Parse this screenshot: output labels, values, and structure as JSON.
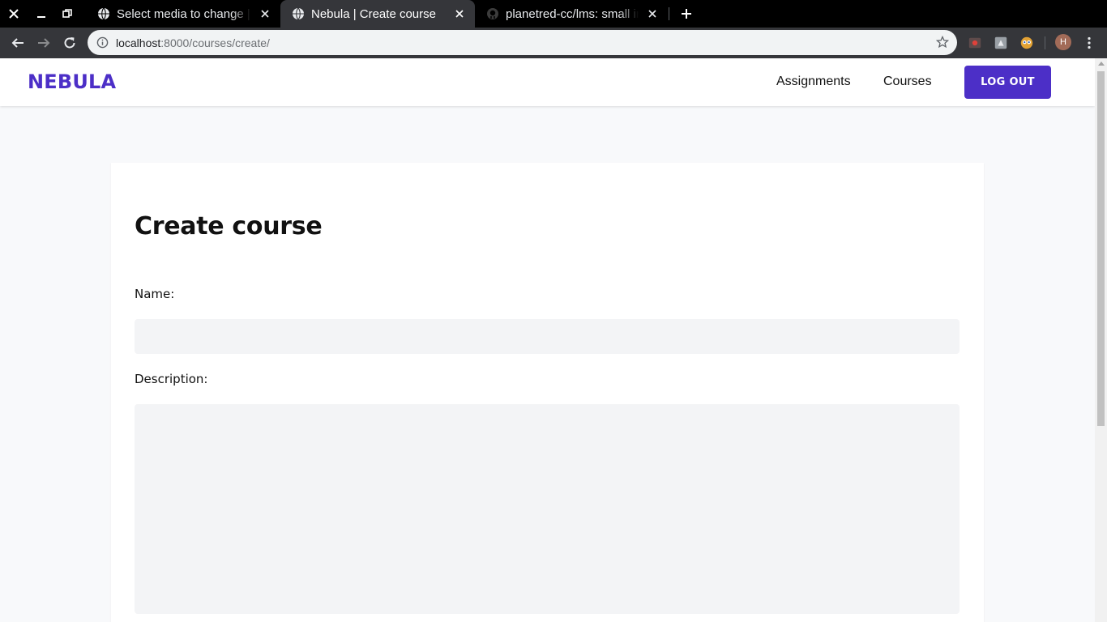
{
  "browser": {
    "tabs": [
      {
        "title": "Select media to change | Django site admin",
        "active": false
      },
      {
        "title": "Nebula | Create course",
        "active": true
      },
      {
        "title": "planetred-cc/lms: small improvements",
        "active": false
      }
    ],
    "url_host": "localhost",
    "url_path": ":8000/courses/create/",
    "profile_initial": "H"
  },
  "header": {
    "brand": "NEBULA",
    "nav": [
      "Assignments",
      "Courses"
    ],
    "logout_label": "LOG OUT"
  },
  "form": {
    "title": "Create course",
    "name_label": "Name:",
    "name_value": "",
    "description_label": "Description:",
    "description_value": ""
  },
  "colors": {
    "accent": "#4c2fc7",
    "input_bg": "#f3f4f6",
    "page_bg": "#f8f9fb"
  }
}
